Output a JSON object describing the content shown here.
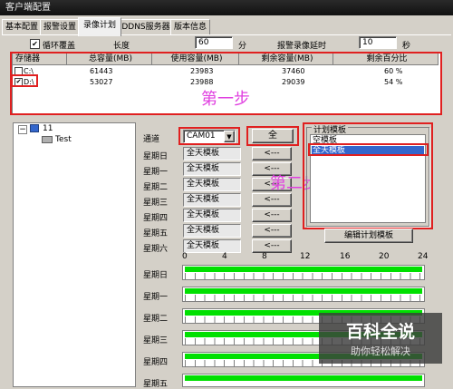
{
  "window": {
    "title": "客户端配置"
  },
  "tabs": [
    {
      "label": "基本配置",
      "active": false
    },
    {
      "label": "报警设置",
      "active": false
    },
    {
      "label": "录像计划",
      "active": true
    },
    {
      "label": "DDNS服务器",
      "active": false
    },
    {
      "label": "版本信息",
      "active": false
    }
  ],
  "settings": {
    "loop_overwrite_label": "循环覆盖",
    "loop_overwrite_checked": true,
    "length_label": "长度",
    "length_value": "60",
    "length_unit": "分",
    "alarm_duration_label": "报警录像延时",
    "alarm_duration_value": "10",
    "alarm_duration_unit": "秒"
  },
  "storage_table": {
    "headers": [
      "存储器",
      "总容量(MB)",
      "使用容量(MB)",
      "剩余容量(MB)",
      "剩余百分比"
    ],
    "rows": [
      {
        "drive": "C:\\",
        "checked": false,
        "total": "61443",
        "used": "23983",
        "free": "37460",
        "percent": "60 %"
      },
      {
        "drive": "D:\\",
        "checked": true,
        "total": "53027",
        "used": "23988",
        "free": "29039",
        "percent": "54 %"
      }
    ]
  },
  "annotations": {
    "step1": "第一步",
    "step2": "第二步"
  },
  "tree": {
    "root": "11",
    "child": "Test"
  },
  "channel": {
    "label": "通道",
    "value": "CAM01",
    "all_button": "全"
  },
  "weekdays": [
    {
      "label": "星期日",
      "template": "全天模板"
    },
    {
      "label": "星期一",
      "template": "全天模板"
    },
    {
      "label": "星期二",
      "template": "全天模板"
    },
    {
      "label": "星期三",
      "template": "全天模板"
    },
    {
      "label": "星期四",
      "template": "全天模板"
    },
    {
      "label": "星期五",
      "template": "全天模板"
    },
    {
      "label": "星期六",
      "template": "全天模板"
    }
  ],
  "assign_button": "<---",
  "plan_templates": {
    "group_label": "计划模板",
    "items": [
      "空模板",
      "全天模板"
    ],
    "selected_index": 1,
    "edit_button": "编辑计划模板"
  },
  "timeline": {
    "hour_labels": [
      "0",
      "4",
      "8",
      "12",
      "16",
      "20",
      "24"
    ],
    "rows": [
      {
        "label": "星期日",
        "coverage": 1.0
      },
      {
        "label": "星期一",
        "coverage": 1.0
      },
      {
        "label": "星期二",
        "coverage": 1.0
      },
      {
        "label": "星期三",
        "coverage": 1.0
      },
      {
        "label": "星期四",
        "coverage": 1.0
      },
      {
        "label": "星期五",
        "coverage": 1.0
      }
    ]
  },
  "watermark": {
    "title": "百科全说",
    "subtitle": "助你轻松解决"
  },
  "colors": {
    "recording_bar": "#00e000",
    "highlight_red": "#e02020",
    "annotation_magenta": "#e040e0",
    "selection_blue": "#3366cc"
  }
}
